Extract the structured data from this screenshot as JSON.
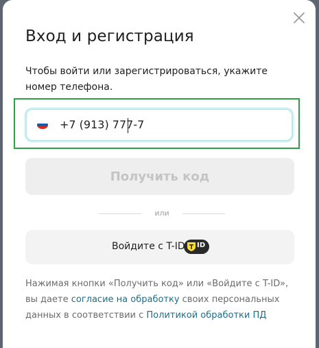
{
  "modal": {
    "title": "Вход и регистрация",
    "subtitle": "Чтобы войти или зарегистрироваться, укажите номер телефона."
  },
  "phone": {
    "country_icon": "russia-flag-icon",
    "value": "+7 (913) 777-7"
  },
  "actions": {
    "get_code_label": "Получить код",
    "divider_label": "или",
    "tid_label": "Войдите с T-ID",
    "tid_badge_text": "ID"
  },
  "legal": {
    "part1": "Нажимая кнопки «Получить код» или «Войдите с T-ID», вы даете ",
    "consent_link": "согласие на обработку",
    "part2": " своих персональных данных в соответствии с ",
    "policy_link": "Политикой обработки ПД"
  },
  "colors": {
    "accent_highlight": "#2e9f45",
    "link": "#1d6e86",
    "tid_badge_bg": "#2a2a2a",
    "tid_shield": "#ffdd2d"
  }
}
